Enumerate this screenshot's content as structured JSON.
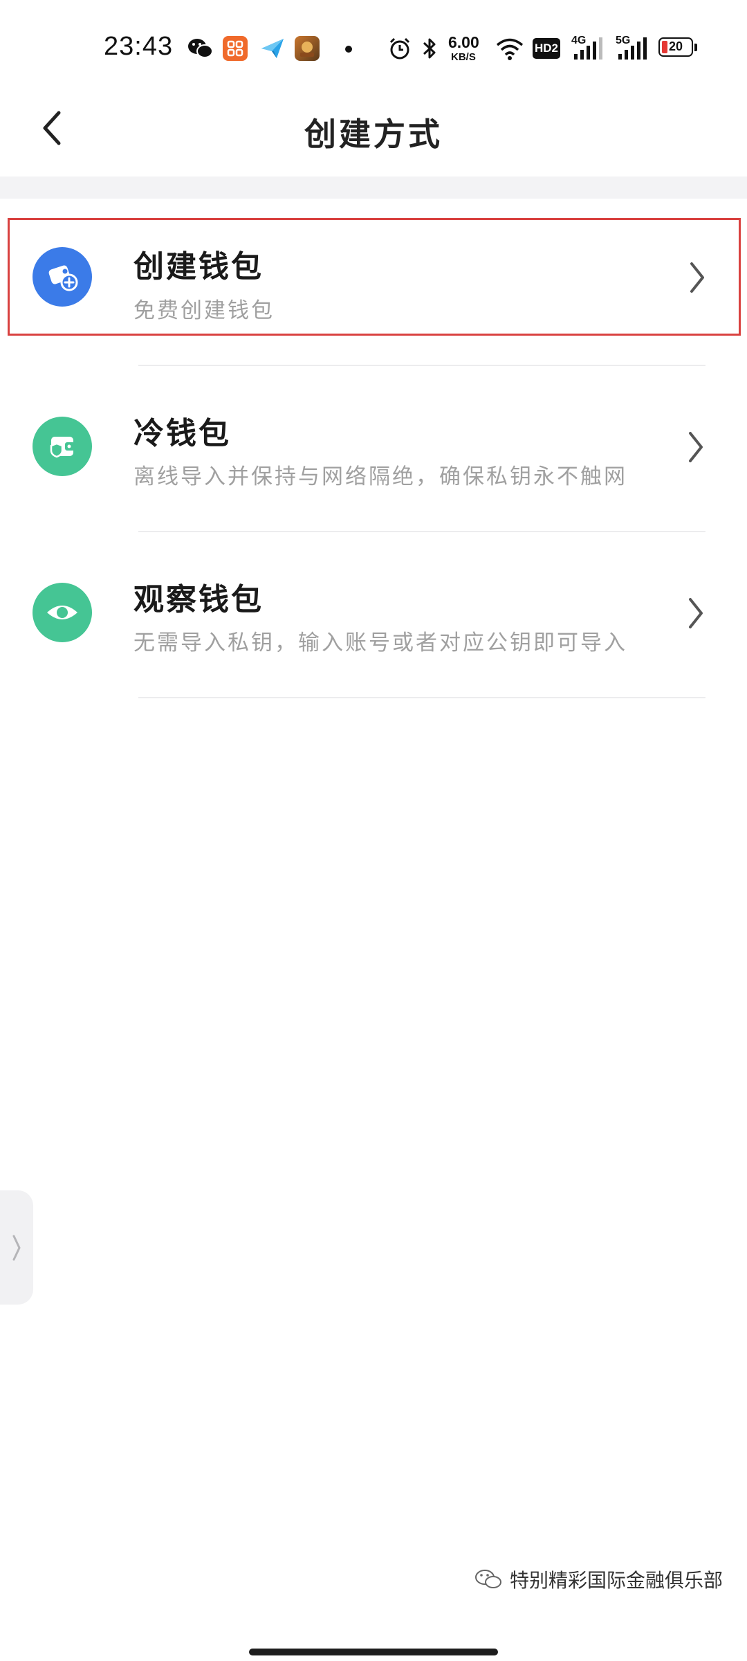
{
  "status_bar": {
    "time": "23:43",
    "net_speed_value": "6.00",
    "net_speed_unit": "KB/S",
    "hd_badge": "HD2",
    "sim1_label": "4G",
    "sim2_label": "5G",
    "battery_level": "20",
    "icons": [
      "wechat-icon",
      "app-icon",
      "paper-plane-icon",
      "game-app-icon",
      "dot-icon",
      "alarm-icon",
      "bluetooth-icon",
      "wifi-icon",
      "signal-icon",
      "battery-icon"
    ]
  },
  "header": {
    "title": "创建方式",
    "back_icon": "chevron-left-icon"
  },
  "options": [
    {
      "title": "创建钱包",
      "subtitle": "免费创建钱包",
      "icon": "wallet-add-icon",
      "icon_color": "#3b7be8",
      "highlighted": true
    },
    {
      "title": "冷钱包",
      "subtitle": "离线导入并保持与网络隔绝，确保私钥永不触网",
      "icon": "shield-wallet-icon",
      "icon_color": "#45c594",
      "highlighted": false
    },
    {
      "title": "观察钱包",
      "subtitle": "无需导入私钥，输入账号或者对应公钥即可导入",
      "icon": "eye-icon",
      "icon_color": "#45c594",
      "highlighted": false
    }
  ],
  "watermark": {
    "text": "特别精彩国际金融俱乐部",
    "icon": "wechat-outline-icon"
  },
  "colors": {
    "highlight_border": "#d9413f",
    "divider": "#ececee",
    "subtitle": "#a0a0a0"
  }
}
